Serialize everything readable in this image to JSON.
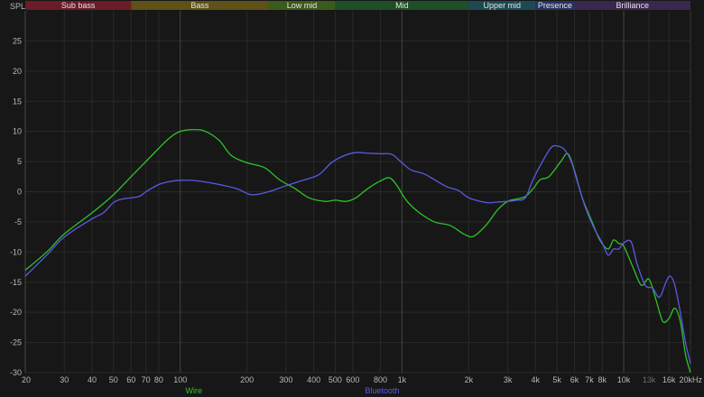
{
  "chart_data": {
    "type": "line",
    "ylabel": "SPL",
    "xscale": "log",
    "xlim": [
      20,
      20000
    ],
    "ylim": [
      -30,
      30
    ],
    "y_ticks": [
      -30,
      -25,
      -20,
      -15,
      -10,
      -5,
      0,
      5,
      10,
      15,
      20,
      25
    ],
    "x_ticks": [
      {
        "value": 20,
        "label": "20"
      },
      {
        "value": 30,
        "label": "30"
      },
      {
        "value": 40,
        "label": "40"
      },
      {
        "value": 50,
        "label": "50"
      },
      {
        "value": 60,
        "label": "60"
      },
      {
        "value": 70,
        "label": "70"
      },
      {
        "value": 80,
        "label": "80"
      },
      {
        "value": 100,
        "label": "100"
      },
      {
        "value": 200,
        "label": "200"
      },
      {
        "value": 300,
        "label": "300"
      },
      {
        "value": 400,
        "label": "400"
      },
      {
        "value": 500,
        "label": "500"
      },
      {
        "value": 600,
        "label": "600"
      },
      {
        "value": 800,
        "label": "800"
      },
      {
        "value": 1000,
        "label": "1k"
      },
      {
        "value": 2000,
        "label": "2k"
      },
      {
        "value": 3000,
        "label": "3k"
      },
      {
        "value": 4000,
        "label": "4k"
      },
      {
        "value": 5000,
        "label": "5k"
      },
      {
        "value": 6000,
        "label": "6k"
      },
      {
        "value": 7000,
        "label": "7k"
      },
      {
        "value": 8000,
        "label": "8k"
      },
      {
        "value": 10000,
        "label": "10k"
      },
      {
        "value": 13000,
        "label": "13k",
        "dim": true
      },
      {
        "value": 16000,
        "label": "16k"
      },
      {
        "value": 20000,
        "label": "20kHz"
      }
    ],
    "major_lines": [
      100,
      1000,
      10000
    ],
    "grid": true,
    "bands": [
      {
        "label": "Sub bass",
        "from": 20,
        "to": 60,
        "color": "#6b1c27"
      },
      {
        "label": "Bass",
        "from": 60,
        "to": 250,
        "color": "#5f5218"
      },
      {
        "label": "Low mid",
        "from": 250,
        "to": 500,
        "color": "#3c5a1c"
      },
      {
        "label": "Mid",
        "from": 500,
        "to": 2000,
        "color": "#1f4f26"
      },
      {
        "label": "Upper mid",
        "from": 2000,
        "to": 4000,
        "color": "#1d4a52"
      },
      {
        "label": "Presence",
        "from": 4000,
        "to": 6000,
        "color": "#28325e"
      },
      {
        "label": "Brilliance",
        "from": 6000,
        "to": 20000,
        "color": "#3a2750"
      }
    ],
    "legend_position": "bottom",
    "series": [
      {
        "name": "Wire",
        "color": "#2fc22a",
        "points": [
          [
            20,
            -13.0
          ],
          [
            25,
            -10.0
          ],
          [
            30,
            -7.0
          ],
          [
            40,
            -3.5
          ],
          [
            50,
            -0.5
          ],
          [
            60,
            2.5
          ],
          [
            70,
            5.0
          ],
          [
            80,
            7.2
          ],
          [
            90,
            9.0
          ],
          [
            100,
            10.0
          ],
          [
            115,
            10.3
          ],
          [
            130,
            10.0
          ],
          [
            150,
            8.5
          ],
          [
            170,
            6.0
          ],
          [
            200,
            4.8
          ],
          [
            240,
            4.0
          ],
          [
            280,
            2.0
          ],
          [
            330,
            0.5
          ],
          [
            380,
            -1.0
          ],
          [
            450,
            -1.6
          ],
          [
            500,
            -1.4
          ],
          [
            560,
            -1.6
          ],
          [
            620,
            -1.0
          ],
          [
            700,
            0.5
          ],
          [
            800,
            1.8
          ],
          [
            880,
            2.3
          ],
          [
            950,
            1.0
          ],
          [
            1050,
            -1.5
          ],
          [
            1200,
            -3.5
          ],
          [
            1400,
            -5.0
          ],
          [
            1650,
            -5.6
          ],
          [
            1900,
            -7.0
          ],
          [
            2100,
            -7.4
          ],
          [
            2400,
            -5.5
          ],
          [
            2700,
            -3.0
          ],
          [
            3000,
            -1.6
          ],
          [
            3300,
            -1.2
          ],
          [
            3600,
            -0.8
          ],
          [
            3900,
            0.5
          ],
          [
            4200,
            2.0
          ],
          [
            4600,
            2.5
          ],
          [
            5200,
            5.0
          ],
          [
            5600,
            6.3
          ],
          [
            6000,
            3.5
          ],
          [
            6500,
            -1.0
          ],
          [
            7200,
            -5.0
          ],
          [
            7800,
            -8.0
          ],
          [
            8500,
            -9.5
          ],
          [
            9000,
            -8.0
          ],
          [
            9500,
            -8.6
          ],
          [
            10000,
            -9.0
          ],
          [
            11000,
            -12.5
          ],
          [
            12000,
            -15.5
          ],
          [
            13000,
            -14.5
          ],
          [
            14000,
            -18.0
          ],
          [
            15000,
            -21.5
          ],
          [
            16000,
            -21.0
          ],
          [
            17000,
            -19.3
          ],
          [
            18000,
            -21.5
          ],
          [
            19000,
            -27.0
          ],
          [
            20000,
            -30.0
          ]
        ]
      },
      {
        "name": "Bluetooth",
        "color": "#5a5ae6",
        "points": [
          [
            20,
            -14.0
          ],
          [
            25,
            -10.5
          ],
          [
            30,
            -7.5
          ],
          [
            40,
            -4.5
          ],
          [
            45,
            -3.5
          ],
          [
            50,
            -1.8
          ],
          [
            55,
            -1.2
          ],
          [
            65,
            -0.8
          ],
          [
            70,
            0.0
          ],
          [
            80,
            1.2
          ],
          [
            90,
            1.7
          ],
          [
            100,
            1.9
          ],
          [
            120,
            1.8
          ],
          [
            150,
            1.2
          ],
          [
            180,
            0.5
          ],
          [
            210,
            -0.5
          ],
          [
            250,
            0.0
          ],
          [
            300,
            1.0
          ],
          [
            350,
            1.8
          ],
          [
            420,
            2.8
          ],
          [
            480,
            4.8
          ],
          [
            550,
            6.0
          ],
          [
            620,
            6.5
          ],
          [
            700,
            6.4
          ],
          [
            800,
            6.3
          ],
          [
            900,
            6.2
          ],
          [
            1000,
            4.8
          ],
          [
            1100,
            3.6
          ],
          [
            1250,
            3.0
          ],
          [
            1400,
            2.0
          ],
          [
            1600,
            0.8
          ],
          [
            1800,
            0.2
          ],
          [
            2000,
            -1.0
          ],
          [
            2400,
            -1.8
          ],
          [
            2700,
            -1.7
          ],
          [
            3000,
            -1.6
          ],
          [
            3300,
            -1.4
          ],
          [
            3600,
            -1.0
          ],
          [
            3900,
            2.0
          ],
          [
            4300,
            5.0
          ],
          [
            4700,
            7.3
          ],
          [
            5000,
            7.6
          ],
          [
            5400,
            7.0
          ],
          [
            5800,
            5.0
          ],
          [
            6200,
            1.5
          ],
          [
            6700,
            -2.5
          ],
          [
            7300,
            -5.8
          ],
          [
            8000,
            -8.5
          ],
          [
            8500,
            -10.5
          ],
          [
            9000,
            -9.5
          ],
          [
            9500,
            -9.5
          ],
          [
            10000,
            -8.5
          ],
          [
            10800,
            -8.3
          ],
          [
            11500,
            -12.0
          ],
          [
            12500,
            -15.5
          ],
          [
            13500,
            -16.0
          ],
          [
            14500,
            -17.5
          ],
          [
            15500,
            -15.0
          ],
          [
            16200,
            -14.0
          ],
          [
            17000,
            -15.5
          ],
          [
            18000,
            -20.0
          ],
          [
            19000,
            -25.0
          ],
          [
            20000,
            -28.5
          ]
        ]
      }
    ]
  }
}
